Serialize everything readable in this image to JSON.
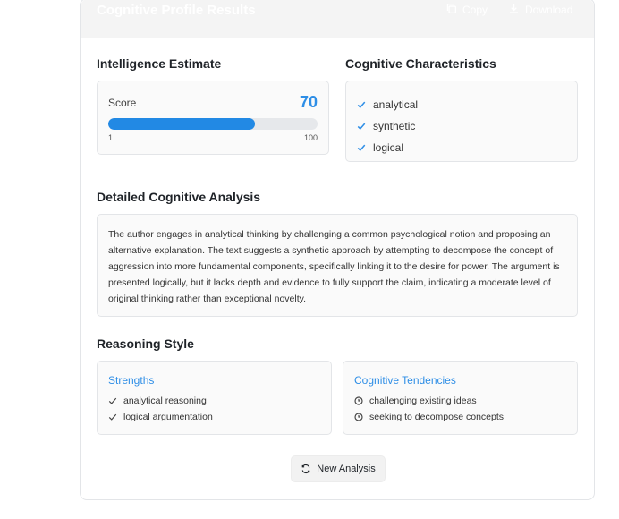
{
  "header": {
    "title": "Cognitive Profile Results",
    "copy_label": "Copy",
    "download_label": "Download"
  },
  "intelligence": {
    "section_title": "Intelligence Estimate",
    "score_label": "Score",
    "score": "70",
    "min": "1",
    "max": "100",
    "fraction": 0.7
  },
  "characteristics": {
    "section_title": "Cognitive Characteristics",
    "items": [
      "analytical",
      "synthetic",
      "logical"
    ]
  },
  "analysis": {
    "section_title": "Detailed Cognitive Analysis",
    "text": "The author engages in analytical thinking by challenging a common psychological notion and proposing an alternative explanation. The text suggests a synthetic approach by attempting to decompose the concept of aggression into more fundamental components, specifically linking it to the desire for power. The argument is presented logically, but it lacks depth and evidence to fully support the claim, indicating a moderate level of original thinking rather than exceptional novelty."
  },
  "reasoning": {
    "section_title": "Reasoning Style",
    "strengths": {
      "title": "Strengths",
      "items": [
        "analytical reasoning",
        "logical argumentation"
      ]
    },
    "tendencies": {
      "title": "Cognitive Tendencies",
      "items": [
        "challenging existing ideas",
        "seeking to decompose concepts"
      ]
    }
  },
  "actions": {
    "new_analysis_label": "New Analysis"
  },
  "colors": {
    "accent": "#2e8ee6",
    "bar": "#2289e4"
  }
}
